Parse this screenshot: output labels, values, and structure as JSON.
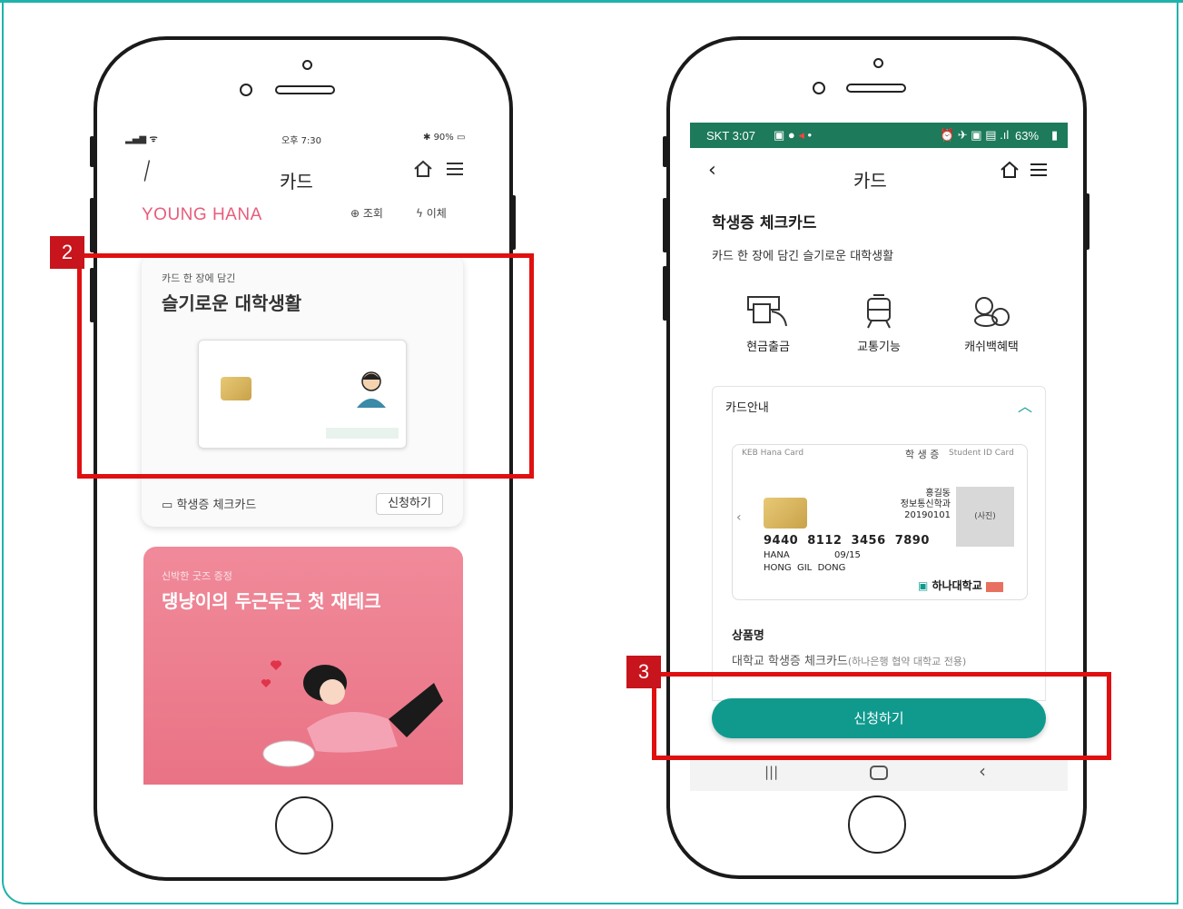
{
  "left_phone": {
    "status": {
      "time": "오후 7:30",
      "battery": "90%"
    },
    "header_title": "카드",
    "brand": "YOUNG HANA",
    "actions": {
      "inquiry": "조회",
      "transfer": "이체"
    },
    "card_promo": {
      "subtitle": "카드 한 장에 담긴",
      "title": "슬기로운 대학생활"
    },
    "card_name": "학생증 체크카드",
    "apply_label": "신청하기",
    "promo2": {
      "subtitle": "신박한 굿즈 증정",
      "title": "댕냥이의 두근두근 첫 재테크"
    },
    "step_badge": "2"
  },
  "right_phone": {
    "status": {
      "carrier_time": "SKT 3:07",
      "battery": "63%"
    },
    "header_title": "카드",
    "product_title": "학생증 체크카드",
    "product_desc": "카드 한 장에 담긴 슬기로운 대학생활",
    "features": [
      {
        "label": "현금출금",
        "icon": "atm-cash-icon"
      },
      {
        "label": "교통기능",
        "icon": "train-icon"
      },
      {
        "label": "캐쉬백혜택",
        "icon": "coins-cashback-icon"
      }
    ],
    "card_info_label": "카드안내",
    "card": {
      "brand": "KEB Hana Card",
      "title": "학 생 증",
      "title_en": "Student ID Card",
      "name": "홍길동",
      "dept": "정보통신학과",
      "student_no": "20190101",
      "photo": "(사진)",
      "number": "9440  8112  3456  7890",
      "bank": "HANA",
      "valid_thru": "09/15",
      "holder": "HONG  GIL  DONG",
      "univ": "하나대학교"
    },
    "product_name_label": "상품명",
    "product_name_value": "대학교 학생증 체크카드",
    "product_name_note": "(하나은행 협약 대학교 전용)",
    "apply_button": "신청하기",
    "step_badge": "3"
  },
  "colors": {
    "teal": "#109a8e",
    "frame": "#20b2aa",
    "highlight_red": "#e01010",
    "brand_pink": "#e85c7a"
  }
}
